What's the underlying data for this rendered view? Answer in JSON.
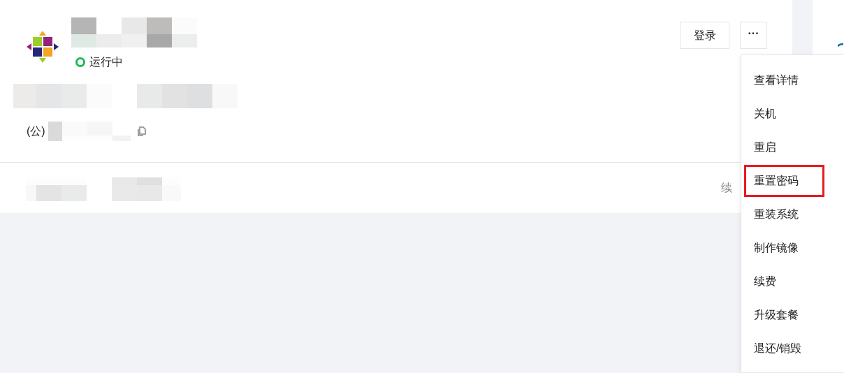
{
  "instance": {
    "status": {
      "label": "运行中",
      "kind": "running"
    },
    "ip_prefix": "(公)",
    "footer_action": "续"
  },
  "buttons": [
    {
      "kind": "text",
      "label": "登录"
    },
    {
      "kind": "more",
      "label": "···"
    }
  ],
  "menu": [
    {
      "label": "查看详情",
      "highlighted": false
    },
    {
      "label": "关机",
      "highlighted": false
    },
    {
      "label": "重启",
      "highlighted": false
    },
    {
      "label": "重置密码",
      "highlighted": true
    },
    {
      "label": "重装系统",
      "highlighted": false
    },
    {
      "label": "制作镜像",
      "highlighted": false
    },
    {
      "label": "续费",
      "highlighted": false
    },
    {
      "label": "升级套餐",
      "highlighted": false
    },
    {
      "label": "退还/销毁",
      "highlighted": false
    }
  ]
}
